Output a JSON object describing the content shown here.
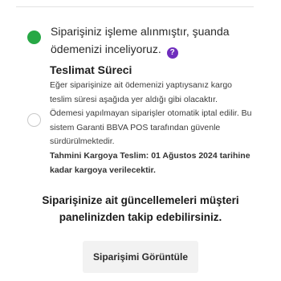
{
  "steps": {
    "received": {
      "text": "Siparişiniz işleme alınmıştır, şuanda ödemenizi inceliyoruz.",
      "help_icon": "?",
      "status_color": "#27a845"
    },
    "shipping": {
      "title": "Teslimat Süreci",
      "body": "Eğer siparişinize ait ödemenizi yaptıysanız kargo teslim süresi aşağıda yer aldığı gibi olacaktır. Ödemesi yapılmayan siparişler otomatik iptal edilir. Bu sistem Garanti BBVA POS tarafından güvenle sürdürülmektedir.",
      "eta": "Tahmini Kargoya Teslim: 01 Ağustos 2024 tarihine kadar kargoya verilecektir."
    }
  },
  "notice": "Siparişinize ait güncellemeleri müşteri panelinizden takip edebilirsiniz.",
  "actions": {
    "view_order_label": "Siparişimi Görüntüle"
  },
  "colors": {
    "accent_purple": "#6f2dbd",
    "success_green": "#27a845"
  }
}
